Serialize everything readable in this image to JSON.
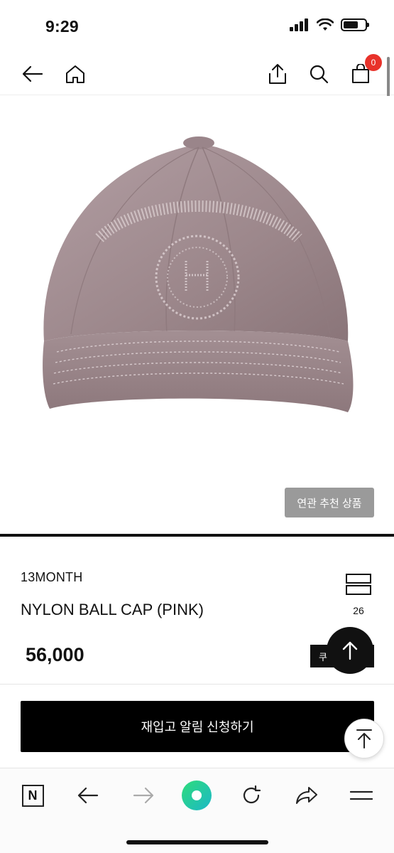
{
  "status_bar": {
    "time": "9:29",
    "battery_level": 0.7
  },
  "header": {
    "cart_count": "0"
  },
  "product": {
    "related_label": "연관 추천 상품",
    "brand": "13MONTH",
    "name": "NYLON BALL CAP (PINK)",
    "compare_count": "26",
    "price": "56,000",
    "coupon_label": "쿠",
    "restock_label": "재입고 알림 신청하기"
  },
  "colors": {
    "cap": "#a08c90",
    "accent": "#000000",
    "badge": "#e8322a"
  },
  "bottom_bar": {
    "naver_label": "N"
  }
}
